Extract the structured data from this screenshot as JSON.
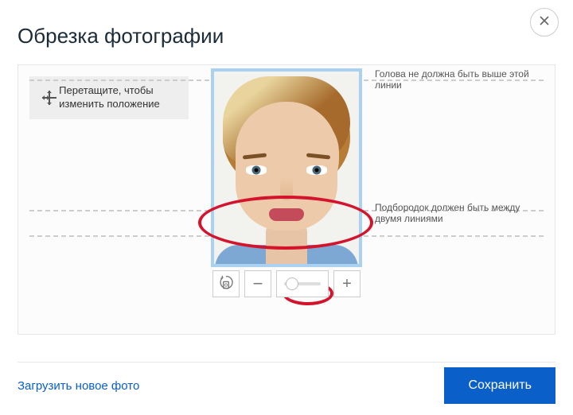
{
  "title": "Обрезка фотографии",
  "hint": "Перетащите, чтобы изменить положение",
  "guides": {
    "top": "Голова не должна быть выше этой линии",
    "bottom": "Подбородок должен быть между двумя линиями"
  },
  "footer": {
    "upload": "Загрузить новое фото",
    "save": "Сохранить"
  },
  "tools": {
    "rotate": "rotate",
    "minus": "−",
    "plus": "+"
  },
  "annotations": {
    "oval_markings": true
  }
}
